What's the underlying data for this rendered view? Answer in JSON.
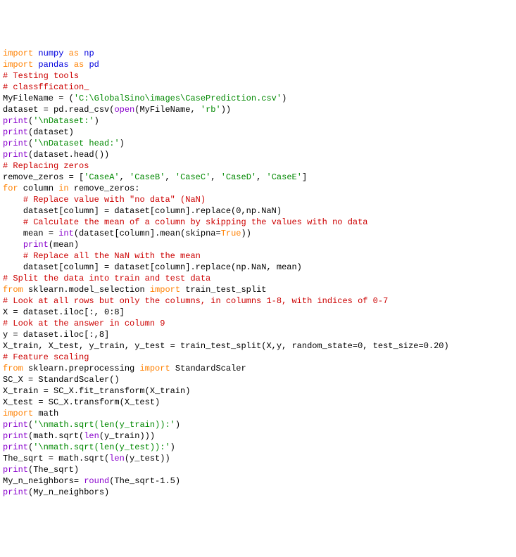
{
  "code": {
    "l01": {
      "import": "import",
      "mod1": "numpy",
      "as": "as",
      "alias1": "np"
    },
    "l02": {
      "import": "import",
      "mod1": "pandas",
      "as": "as",
      "alias1": "pd"
    },
    "l03": {
      "comment": "# Testing tools"
    },
    "l04": {
      "blank": ""
    },
    "l05": {
      "comment": "# classffication_"
    },
    "l06": {
      "blank": ""
    },
    "l07": {
      "var": "MyFileName = (",
      "str": "'C:\\GlobalSino\\images\\CasePrediction.csv'",
      "end": ")"
    },
    "l08": {
      "blank": ""
    },
    "l09": {
      "p1": "dataset = pd.read_csv(",
      "fn": "open",
      "p2": "(MyFileName, ",
      "str": "'rb'",
      "p3": "))"
    },
    "l10": {
      "fn": "print",
      "p1": "(",
      "str": "'\\nDataset:'",
      "p2": ")"
    },
    "l11": {
      "fn": "print",
      "p1": "(dataset)"
    },
    "l12": {
      "fn": "print",
      "p1": "(",
      "str": "'\\nDataset head:'",
      "p2": ")"
    },
    "l13": {
      "fn": "print",
      "p1": "(dataset.head())"
    },
    "l14": {
      "blank": ""
    },
    "l15": {
      "comment": "# Replacing zeros"
    },
    "l16": {
      "p1": "remove_zeros = [",
      "s1": "'CaseA'",
      "c1": ", ",
      "s2": "'CaseB'",
      "c2": ", ",
      "s3": "'CaseC'",
      "c3": ", ",
      "s4": "'CaseD'",
      "c4": ", ",
      "s5": "'CaseE'",
      "p2": "]"
    },
    "l17": {
      "blank": ""
    },
    "l18": {
      "for": "for",
      "p1": " column ",
      "in": "in",
      "p2": " remove_zeros:"
    },
    "l19": {
      "indent": "    ",
      "comment": "# Replace value with \"no data\" (NaN)"
    },
    "l20": {
      "indent": "    ",
      "p1": "dataset[column] = dataset[column].replace(0,np.NaN)"
    },
    "l21": {
      "indent": "    ",
      "comment": "# Calculate the mean of a column by skipping the values with no data"
    },
    "l22": {
      "indent": "    ",
      "p1": "mean = ",
      "fn": "int",
      "p2": "(dataset[column].mean(skipna=",
      "bool": "True",
      "p3": "))"
    },
    "l23": {
      "indent": "    ",
      "fn": "print",
      "p1": "(mean)"
    },
    "l24": {
      "indent": "    ",
      "comment": "# Replace all the NaN with the mean"
    },
    "l25": {
      "indent": "    ",
      "p1": "dataset[column] = dataset[column].replace(np.NaN, mean)"
    },
    "l26": {
      "blank": ""
    },
    "l27": {
      "comment": "# Split the data into train and test data"
    },
    "l28": {
      "from": "from",
      "p1": " sklearn.model_selection ",
      "import": "import",
      "p2": " train_test_split"
    },
    "l29": {
      "comment": "# Look at all rows but only the columns, in columns 1-8, with indices of 0-7"
    },
    "l30": {
      "p1": "X = dataset.iloc[:, 0:8]"
    },
    "l31": {
      "comment": "# Look at the answer in column 9"
    },
    "l32": {
      "p1": "y = dataset.iloc[:,8]"
    },
    "l33": {
      "p1": "X_train, X_test, y_train, y_test = train_test_split(X,y, random_state=0, test_size=0.20)"
    },
    "l34": {
      "blank": ""
    },
    "l35": {
      "comment": "# Feature scaling"
    },
    "l36": {
      "from": "from",
      "p1": " sklearn.preprocessing ",
      "import": "import",
      "p2": " StandardScaler"
    },
    "l37": {
      "p1": "SC_X = StandardScaler()"
    },
    "l38": {
      "p1": "X_train = SC_X.fit_transform(X_train)"
    },
    "l39": {
      "p1": "X_test = SC_X.transform(X_test)"
    },
    "l40": {
      "blank": ""
    },
    "l41": {
      "import": "import",
      "p1": " math"
    },
    "l42": {
      "fn": "print",
      "p1": "(",
      "str": "'\\nmath.sqrt(len(y_train)):'",
      "p2": ")"
    },
    "l43": {
      "fn": "print",
      "p1": "(math.sqrt(",
      "fn2": "len",
      "p2": "(y_train)))"
    },
    "l44": {
      "fn": "print",
      "p1": "(",
      "str": "'\\nmath.sqrt(len(y_test)):'",
      "p2": ")"
    },
    "l45": {
      "p1": "The_sqrt = math.sqrt(",
      "fn": "len",
      "p2": "(y_test))"
    },
    "l46": {
      "fn": "print",
      "p1": "(The_sqrt)"
    },
    "l47": {
      "p1": "My_n_neighbors= ",
      "fn": "round",
      "p2": "(The_sqrt-1.5)"
    },
    "l48": {
      "fn": "print",
      "p1": "(My_n_neighbors)"
    }
  }
}
